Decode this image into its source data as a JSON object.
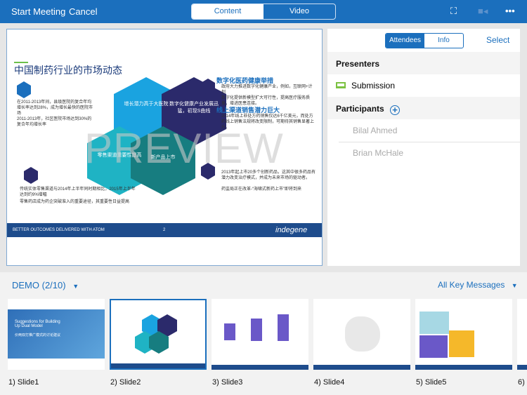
{
  "header": {
    "start_label": "Start Meeting",
    "cancel_label": "Cancel",
    "tabs": [
      {
        "label": "Content",
        "active": true
      },
      {
        "label": "Video",
        "active": false
      }
    ]
  },
  "slide": {
    "title": "中国制药行业的市场动态",
    "left_bullets": [
      "在2011-2013年间，县级医院的复合年均增长率达到28%，成为增长最快的医院市场",
      "2011-2013年，社区医院市场达到30%的复合年均增长率"
    ],
    "bottom_left_bullets": [
      "传统实体零售渠道与2014年上半年同时期相比，2015年上半年达到约9%增幅",
      "零售药店成为药企突破准入的重要途径，其重要性日益提高"
    ],
    "heading1": "数字化医药健康举措",
    "h1_bullets": [
      "政府大力推进数字化健康产业，例如，互联网+计划",
      "数字化提供新模型扩大可行性，提高医疗服务质量，增进医患连接。"
    ],
    "heading2": "线上渠道销售潜力巨大",
    "h2_bullets": [
      "2014年线上非处方药销售仅达6千亿美元，而处方药线上销售法规将改变限制，可期待其销售显著上升。"
    ],
    "bottom_right_bullets": [
      "2013年起上市20多个创新药品，这其中很多药品有潜力改变治疗模式，并成为未来市场的驱动者。",
      "药监局正在改革-“海啸式新药上市”即将到来"
    ],
    "hexes": [
      "增长潜力高于大医院",
      "数字化健康产业发展迅猛，初现S曲线",
      "零售渠道重要性提高",
      "新产品上市"
    ],
    "watermark": "PREVIEW",
    "footer_text": "BETTER OUTCOMES DELIVERED WITH ATOM",
    "page_number": "2",
    "brand": "indegene"
  },
  "panel": {
    "tabs": [
      {
        "label": "Attendees",
        "active": true
      },
      {
        "label": "Info",
        "active": false
      }
    ],
    "select_label": "Select",
    "presenters_label": "Presenters",
    "presenters": [
      "Submission"
    ],
    "participants_label": "Participants",
    "participants": [
      "Bilal Ahmed",
      "Brian McHale"
    ]
  },
  "strip": {
    "deck_label": "DEMO  (2/10)",
    "filter_label": "All Key Messages",
    "slides": [
      "1) Slide1",
      "2) Slide2",
      "3) Slide3",
      "4) Slide4",
      "5) Slide5",
      "6)"
    ],
    "selected": 2,
    "slide1_title": "Suggestions for Building Up Dual Model",
    "slide1_subtitle": "价两双打推广模式的讨论建议"
  },
  "colors": {
    "brand": "#1b6fbd",
    "hex_light": "#1aa3e0",
    "hex_navy": "#2b2a6b",
    "hex_teal": "#1fb3c4",
    "hex_dark_teal": "#177d80",
    "laptop": "#7cc242"
  }
}
